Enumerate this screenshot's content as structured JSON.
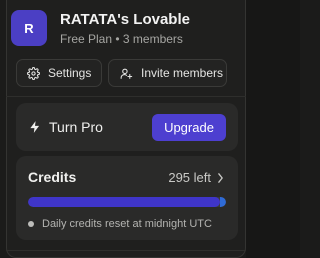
{
  "workspace": {
    "avatar_letter": "R",
    "name": "RATATA's Lovable",
    "plan_info": "Free Plan • 3 members"
  },
  "actions": {
    "settings_label": "Settings",
    "invite_label": "Invite members"
  },
  "pro": {
    "label": "Turn Pro",
    "upgrade_label": "Upgrade"
  },
  "credits": {
    "title": "Credits",
    "left_label": "295 left",
    "used_fraction": 0.97,
    "reset_note": "Daily credits reset at midnight UTC"
  },
  "colors": {
    "accent": "#4d3fd0",
    "avatar_bg": "#4b3fc4",
    "progress_fill": "#3f35c9"
  },
  "icons": {
    "settings": "gear-icon",
    "invite": "add-user-icon",
    "pro": "lightning-icon",
    "credits_more": "chevron-right-icon"
  }
}
